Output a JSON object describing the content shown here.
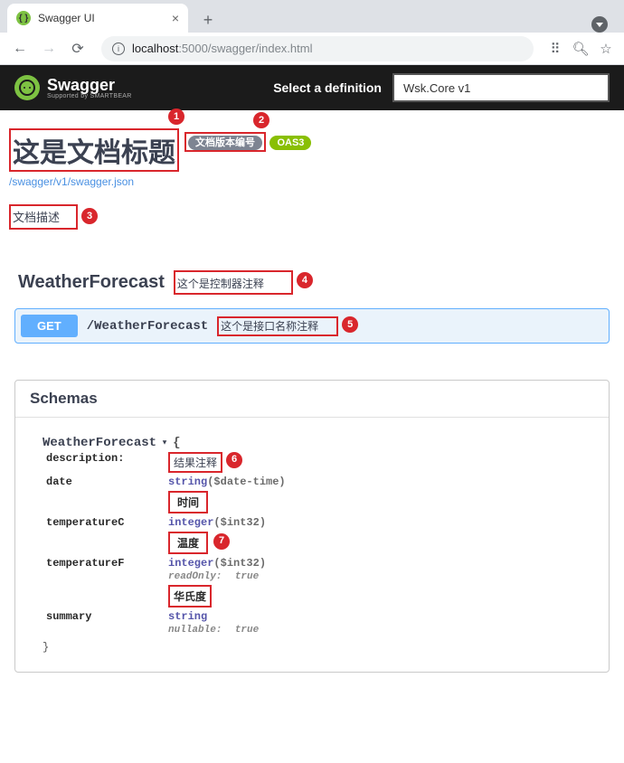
{
  "browser": {
    "tab_title": "Swagger UI",
    "url_host": "localhost",
    "url_port": ":5000",
    "url_path": "/swagger/index.html"
  },
  "topbar": {
    "brand": "Swagger",
    "brand_sub": "Supported by SMARTBEAR",
    "select_label": "Select a definition",
    "selected_def": "Wsk.Core v1"
  },
  "info": {
    "title": "这是文档标题",
    "version_badge": "文档版本编号",
    "oas_badge": "OAS3",
    "link": "/swagger/v1/swagger.json",
    "description": "文档描述"
  },
  "tag": {
    "name": "WeatherForecast",
    "description": "这个是控制器注释"
  },
  "operation": {
    "method": "GET",
    "path": "/WeatherForecast",
    "summary": "这个是接口名称注释"
  },
  "schemas": {
    "header": "Schemas",
    "model_name": "WeatherForecast",
    "description_label": "description:",
    "description_value": "结果注释",
    "props": {
      "date": {
        "name": "date",
        "type": "string",
        "format": "($date-time)",
        "desc": "时间"
      },
      "temperatureC": {
        "name": "temperatureC",
        "type": "integer",
        "format": "($int32)",
        "desc": "温度"
      },
      "temperatureF": {
        "name": "temperatureF",
        "type": "integer",
        "format": "($int32)",
        "readonly_label": "readOnly:",
        "readonly_value": "true",
        "desc": "华氏度"
      },
      "summary": {
        "name": "summary",
        "type": "string",
        "nullable_label": "nullable:",
        "nullable_value": "true"
      }
    }
  },
  "callouts": {
    "c1": "1",
    "c2": "2",
    "c3": "3",
    "c4": "4",
    "c5": "5",
    "c6": "6",
    "c7": "7"
  }
}
